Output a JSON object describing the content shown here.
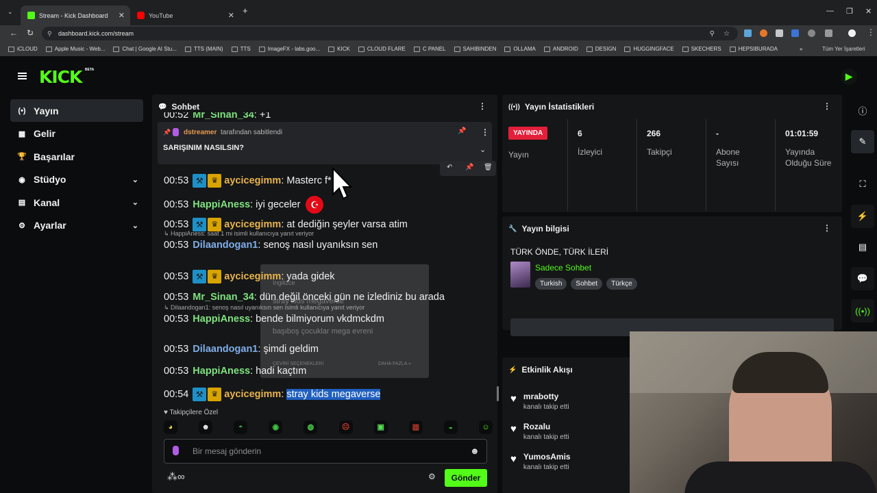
{
  "browser": {
    "tabs": [
      {
        "label": "Stream - Kick Dashboard",
        "fav_color": "#53fc18"
      },
      {
        "label": "YouTube",
        "fav_color": "#ff0000"
      }
    ],
    "url": "dashboard.kick.com/stream",
    "bookmarks": [
      "iCLOUD",
      "Apple Music - Web...",
      "Chat | Google AI Stu...",
      "TTS (MAIN)",
      "TTS",
      "ImageFX - labs.goo...",
      "KICK",
      "CLOUD FLARE",
      "C PANEL",
      "SAHIBINDEN",
      "OLLAMA",
      "ANDROID",
      "DESIGN",
      "HUGGINGFACE",
      "SKECHERS",
      "HEPSIBURADA"
    ],
    "bookmarks_more": "»",
    "all_bookmarks": "Tüm Yer İşaretleri"
  },
  "app": {
    "logo": "KICK",
    "beta": "BETA"
  },
  "sidebar": {
    "items": [
      {
        "label": "Yayın",
        "icon": "live-icon",
        "glyph": "(•)",
        "expandable": false
      },
      {
        "label": "Gelir",
        "icon": "revenue-icon",
        "glyph": "▦",
        "expandable": false
      },
      {
        "label": "Başarılar",
        "icon": "trophy-icon",
        "glyph": "🏆",
        "expandable": false
      },
      {
        "label": "Stüdyo",
        "icon": "studio-icon",
        "glyph": "◉",
        "expandable": true
      },
      {
        "label": "Kanal",
        "icon": "channel-icon",
        "glyph": "▤",
        "expandable": true
      },
      {
        "label": "Ayarlar",
        "icon": "settings-icon",
        "glyph": "⚙",
        "expandable": true
      }
    ]
  },
  "chat": {
    "title": "Sohbet",
    "partial_top": {
      "time": "00:52",
      "user": "Mr_Sinan_34",
      "text": "+1"
    },
    "pinned": {
      "by_user": "dstreamer",
      "by_suffix": "tarafından sabitlendi",
      "text": "SARIŞINIM NASILSIN?"
    },
    "messages": [
      {
        "time": "00:53",
        "user": "aycicegimm",
        "color": "#e8b44a",
        "badges": true,
        "text": "Masterc  f*"
      },
      {
        "time": "00:53",
        "user": "HappiAness",
        "color": "#7ee37e",
        "badges": false,
        "text": "iyi geceler"
      },
      {
        "time": "00:53",
        "user": "aycicegimm",
        "color": "#e8b44a",
        "badges": true,
        "text": "at dediğin şeyler varsa atim"
      },
      {
        "time": "00:53",
        "user": "Dilaandogan1",
        "color": "#7faee8",
        "badges": false,
        "text": "senoş nasıl uyanıksın sen",
        "reply": "HappiAness: saat 1 mi isimli kullanıcıya yanıt veriyor"
      },
      {
        "time": "00:53",
        "user": "aycicegimm",
        "color": "#e8b44a",
        "badges": true,
        "text": "yada gidek"
      },
      {
        "time": "00:53",
        "user": "Mr_Sinan_34",
        "color": "#7ee37e",
        "badges": false,
        "text": "dün değil önceki gün ne izlediniz bu arada"
      },
      {
        "time": "00:53",
        "user": "HappiAness",
        "color": "#7ee37e",
        "badges": false,
        "text": "bende bilmiyorum vkdmckdm",
        "reply": "Dilaandogan1: senoş nasıl uyanıksın sen isimli kullanıcıya yanıt veriyor"
      },
      {
        "time": "00:53",
        "user": "Dilaandogan1",
        "color": "#7faee8",
        "badges": false,
        "text": "şimdi geldim"
      },
      {
        "time": "00:53",
        "user": "HappiAness",
        "color": "#7ee37e",
        "badges": false,
        "text": "hadi kaçtım"
      },
      {
        "time": "00:54",
        "user": "aycicegimm",
        "color": "#e8b44a",
        "badges": true,
        "text": "stray kids megaverse",
        "highlighted": true
      }
    ],
    "translate_popup": {
      "lang": "İngilizce",
      "line1": "stray kids megaverse",
      "line2": "başıboş çocuklar mega evreni",
      "footer_left": "ÇEVİRİ SEÇENEKLERİ",
      "footer_right": "DAHA FAZLA »"
    },
    "followers_only": "Takipçilere Özel",
    "emotes": [
      {
        "color": "#e7d44a",
        "glyph": "◕"
      },
      {
        "color": "#f2f2f2",
        "glyph": "☻"
      },
      {
        "color": "#4aa84a",
        "glyph": "◓"
      },
      {
        "color": "#3fc43f",
        "glyph": "◉"
      },
      {
        "color": "#4fcf4f",
        "glyph": "◍"
      },
      {
        "color": "#c73a2a",
        "glyph": "☹"
      },
      {
        "color": "#55dd55",
        "glyph": "▣"
      },
      {
        "color": "#c23a2a",
        "glyph": "▥"
      },
      {
        "color": "#3fbf3f",
        "glyph": "◒"
      },
      {
        "color": "#53fc18",
        "glyph": "☺"
      }
    ],
    "input_placeholder": "Bir mesaj gönderin",
    "send": "Gönder"
  },
  "stats": {
    "title": "Yayın İstatistikleri",
    "live_badge": "YAYINDA",
    "cells": [
      {
        "value": "",
        "label": "Yayın"
      },
      {
        "value": "6",
        "label": "İzleyici"
      },
      {
        "value": "266",
        "label": "Takipçi"
      },
      {
        "value": "-",
        "label": "Abone\nSayısı"
      },
      {
        "value": "01:01:59",
        "label": "Yayında\nOlduğu Süre"
      }
    ]
  },
  "info": {
    "title": "Yayın bilgisi",
    "stream_title": "TÜRK ÖNDE, TÜRK İLERİ",
    "category": "Sadece Sohbet",
    "tags": [
      "Turkish",
      "Sohbet",
      "Türkçe"
    ]
  },
  "events": {
    "title": "Etkinlik Akışı",
    "items": [
      {
        "user": "mrabotty",
        "action": "kanalı takip etti"
      },
      {
        "user": "Rozalu",
        "action": "kanalı takip etti"
      },
      {
        "user": "YumosAmis",
        "action": "kanalı takip etti"
      }
    ]
  },
  "colors": {
    "brand": "#53fc18",
    "live": "#e41f3a",
    "panel": "#151618"
  }
}
